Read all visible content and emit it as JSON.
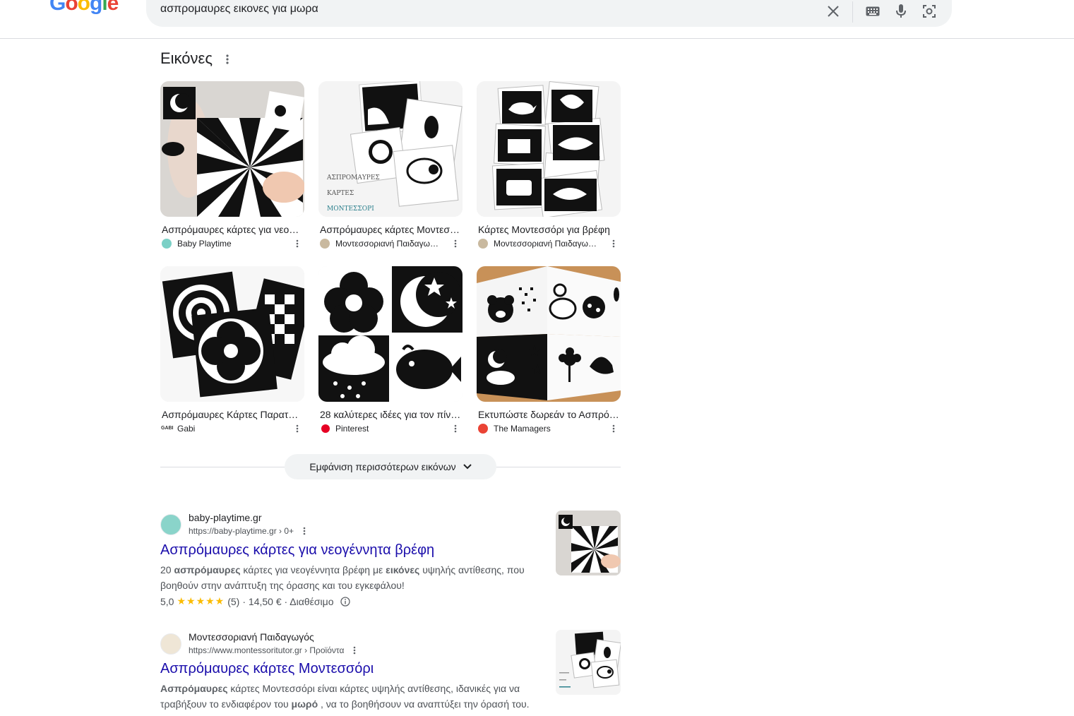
{
  "header": {
    "logo_text": "Google",
    "search_query": "ασπρομαυρες εικονες για μωρα",
    "icons": [
      "clear-icon",
      "keyboard-icon",
      "mic-icon",
      "lens-icon"
    ]
  },
  "images": {
    "title": "Εικόνες",
    "items": [
      {
        "caption": "Ασπρόμαυρες κάρτες για νεο…",
        "source": "Baby Playtime"
      },
      {
        "caption": "Ασπρόμαυρες κάρτες Μοντεσ…",
        "source": "Μοντεσσοριανή Παιδαγω…"
      },
      {
        "caption": "Κάρτες Μοντεσσόρι για βρέφη",
        "source": "Μοντεσσοριανή Παιδαγω…"
      },
      {
        "caption": "Ασπρόμαυρες Κάρτες Παρατ…",
        "source": "Gabi"
      },
      {
        "caption": "28 καλύτερες ιδέες για τον πίν…",
        "source": "Pinterest"
      },
      {
        "caption": "Εκτυπώστε δωρεάν το Ασπρό…",
        "source": "The Mamagers"
      }
    ],
    "thumb_overlays": {
      "card_text": [
        "ΑΣΠΡΟΜΑΥΡΕΣ",
        "ΚΑΡΤΕΣ",
        "ΜΟΝΤΕΣΣΟΡΙ"
      ]
    },
    "more_button": "Εμφάνιση περισσότερων εικόνων"
  },
  "results": [
    {
      "site": "baby-playtime.gr",
      "url": "https://baby-playtime.gr › 0+",
      "title": "Ασπρόμαυρες κάρτες για νεογέννητα βρέφη",
      "snippet_parts": [
        "20 ",
        "ασπρόμαυρες",
        " κάρτες για νεογέννητα βρέφη με ",
        "εικόνες",
        " υψηλής αντίθεσης, που βοηθούν στην ανάπτυξη της όρασης και του εγκεφάλου!"
      ],
      "rating": "5,0",
      "stars": "★★★★★",
      "reviews": "(5)",
      "price": "· 14,50 € · Διαθέσιμο"
    },
    {
      "site": "Μοντεσσοριανή Παιδαγωγός",
      "url": "https://www.montessoritutor.gr › Προϊόντα",
      "title": "Ασπρόμαυρες κάρτες Μοντεσσόρι",
      "snippet_parts": [
        "Ασπρόμαυρες",
        " κάρτες Μοντεσσόρι είναι κάρτες υψηλής αντίθεσης, ιδανικές για να τραβήξουν το ενδιαφέρον του ",
        "μωρό",
        " , να το βοηθήσουν να αναπτύξει την όρασή του."
      ]
    }
  ],
  "colors": {
    "link": "#1a0dab",
    "google_blue": "#4285f4",
    "google_red": "#ea4335",
    "google_yellow": "#fbbc05",
    "google_green": "#34a853",
    "star": "#fbbc04"
  }
}
